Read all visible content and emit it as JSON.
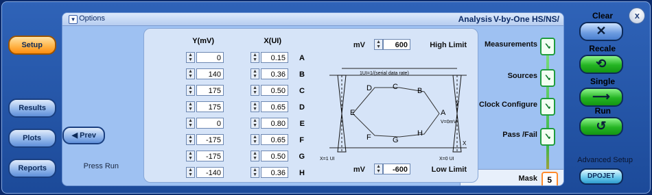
{
  "window": {
    "title": "V-by-One HS/NS/",
    "subtitle": "Analysis",
    "options_label": "Options",
    "options_arrow": "▼"
  },
  "controls": {
    "close_label": "x",
    "clear_label": "Clear",
    "clear_icon": "✕",
    "recall_label": "Recale",
    "recall_icon": "⟳",
    "single_label": "Single",
    "single_icon": "⟵",
    "run_label": "Run",
    "run_icon": "↻",
    "advanced_label": "Advanced Setup",
    "dpojet_label": "DPOJET"
  },
  "nav": {
    "items": [
      {
        "label": "Measurements",
        "icon": "check-icon"
      },
      {
        "label": "Sources",
        "icon": "check-icon"
      },
      {
        "label": "Clock Configure",
        "icon": "check-icon"
      },
      {
        "label": "Pass /Fail",
        "icon": "check-icon"
      }
    ],
    "check_glyph": "✓",
    "mask": {
      "number": "5",
      "label": "Mask"
    }
  },
  "limits": {
    "high": {
      "label": "High Limit",
      "value": "600",
      "unit": "mV"
    },
    "low": {
      "label": "Low Limit",
      "value": "-600",
      "unit": "mV"
    }
  },
  "diagram": {
    "ui_caption": "1UI=1/(serial data rate)",
    "x1_label": "X=1 UI",
    "x0_label": "X=0 UI",
    "v_label": "V=0mV",
    "y_axis": "Y",
    "x_axis": "X",
    "points": [
      "A",
      "B",
      "C",
      "D",
      "E",
      "F",
      "G",
      "H"
    ]
  },
  "table": {
    "col_x": "X(UI)",
    "col_y": "Y(mV)",
    "rows": [
      {
        "label": "A",
        "x": "0.15",
        "y": "0"
      },
      {
        "label": "B",
        "x": "0.36",
        "y": "140"
      },
      {
        "label": "C",
        "x": "0.50",
        "y": "175"
      },
      {
        "label": "D",
        "x": "0.65",
        "y": "175"
      },
      {
        "label": "E",
        "x": "0.80",
        "y": "0"
      },
      {
        "label": "F",
        "x": "0.65",
        "y": "-175"
      },
      {
        "label": "G",
        "x": "0.50",
        "y": "-175"
      },
      {
        "label": "H",
        "x": "0.36",
        "y": "-140"
      }
    ]
  },
  "prev_label": "◀ Prev",
  "press_run": "Press Run",
  "side_buttons": {
    "setup": "Setup",
    "results": "Results",
    "plots": "Plots",
    "reports": "Reports"
  },
  "colors": {
    "accent_orange": "#ff8c10",
    "check_green": "#1f9c3e"
  }
}
